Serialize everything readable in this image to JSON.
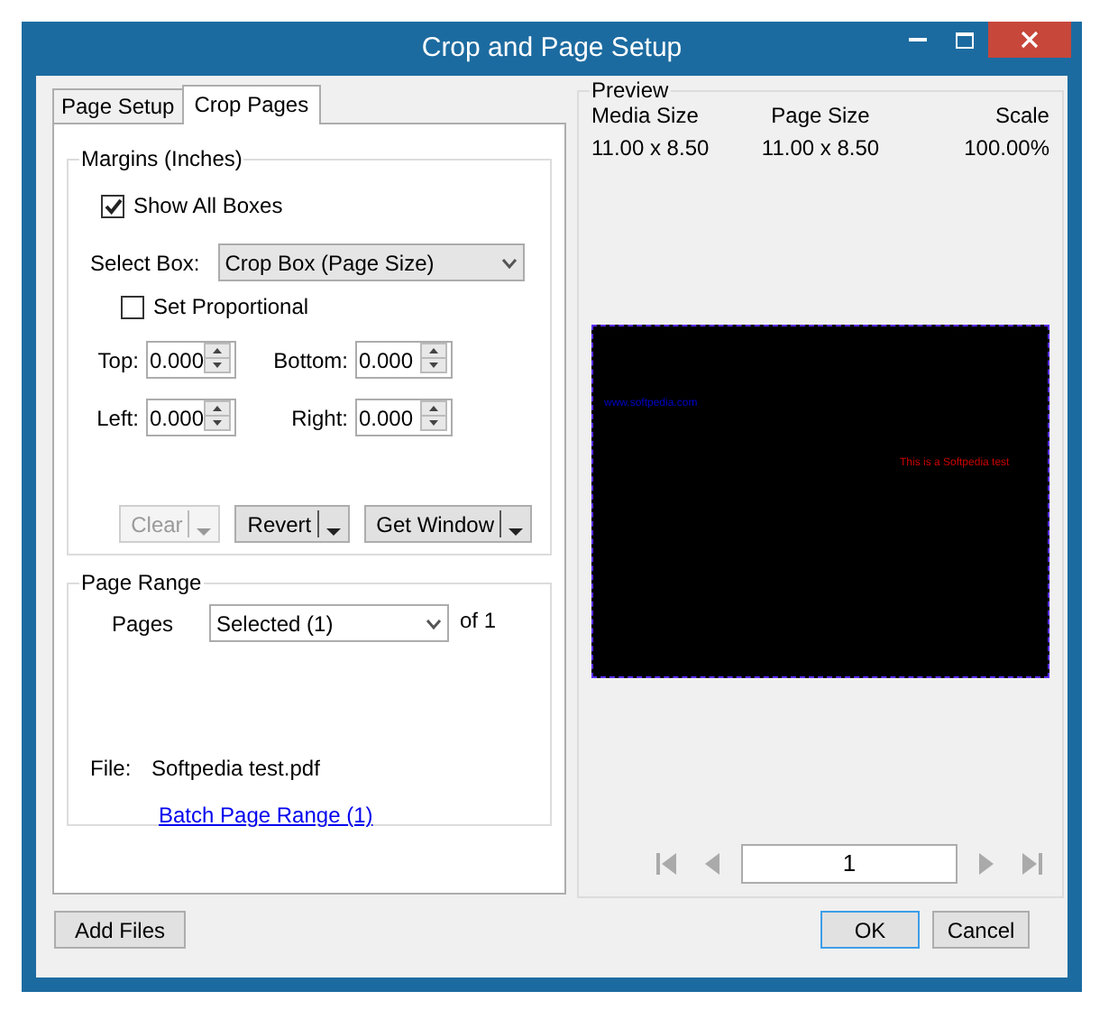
{
  "window": {
    "title": "Crop and Page Setup"
  },
  "tabs": [
    {
      "label": "Page Setup",
      "selected": false
    },
    {
      "label": "Crop Pages",
      "selected": true
    }
  ],
  "margins": {
    "title": "Margins (Inches)",
    "show_all_boxes": {
      "label": "Show All Boxes",
      "checked": true
    },
    "select_box": {
      "label": "Select Box:",
      "value": "Crop Box (Page Size)"
    },
    "set_proportional": {
      "label": "Set Proportional",
      "checked": false
    },
    "fields": [
      {
        "label": "Top:",
        "value": "0.000"
      },
      {
        "label": "Bottom:",
        "value": "0.000"
      },
      {
        "label": "Left:",
        "value": "0.000"
      },
      {
        "label": "Right:",
        "value": "0.000"
      }
    ],
    "buttons": [
      {
        "label": "Clear",
        "disabled": true
      },
      {
        "label": "Revert",
        "disabled": false
      },
      {
        "label": "Get Window",
        "disabled": false
      }
    ]
  },
  "page_range": {
    "title": "Page Range",
    "pages_label": "Pages",
    "pages_value": "Selected (1)",
    "of_text": "of 1",
    "file_label": "File:",
    "file_name": "Softpedia test.pdf",
    "link": "Batch Page Range (1)"
  },
  "preview": {
    "title": "Preview",
    "columns": [
      {
        "heading": "Media Size",
        "value": "11.00 x 8.50"
      },
      {
        "heading": "Page Size",
        "value": "11.00 x 8.50"
      },
      {
        "heading": "Scale",
        "value": "100.00%"
      }
    ],
    "page_texts": [
      {
        "text": "www.softpedia.com",
        "color": "#0000cc"
      },
      {
        "text": "This is a Softpedia test",
        "color": "#cc0000"
      }
    ],
    "page_number": "1"
  },
  "buttons": [
    {
      "label": "Add Files",
      "default": false
    },
    {
      "label": "OK",
      "default": true
    },
    {
      "label": "Cancel",
      "default": false
    }
  ]
}
